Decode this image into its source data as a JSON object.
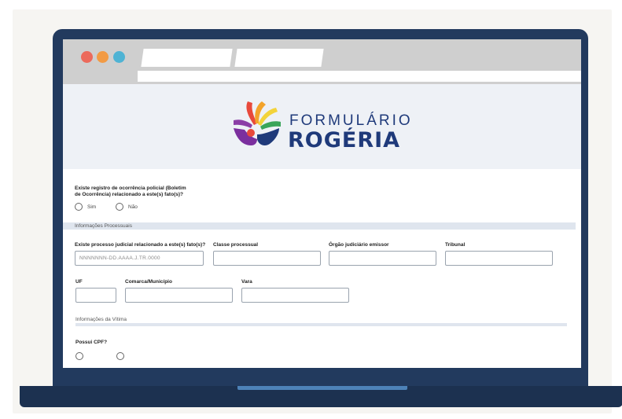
{
  "logo": {
    "line1": "FORMULÁRIO",
    "line2": "ROGÉRIA"
  },
  "question_bo": {
    "label_line1": "Existe registro de ocorrência policial (Boletim",
    "label_line2": "de Ocorrência) relacionado a este(s) fato(s)?",
    "option_yes": "Sim",
    "option_no": "Não"
  },
  "sections": {
    "processuais": "Informações Processuais",
    "vitima": "Informações da Vítima"
  },
  "fields": {
    "processo_label": "Existe processo judicial relacionado a este(s) fato(s)?",
    "processo_placeholder": "NNNNNNN-DD.AAAA.J.TR.0000",
    "classe_label": "Classe processual",
    "orgao_label": "Órgão judiciário emissor",
    "tribunal_label": "Tribunal",
    "uf_label": "UF",
    "comarca_label": "Comarca/Município",
    "vara_label": "Vara",
    "cpf_label": "Possui CPF?"
  },
  "colors": {
    "brand": "#1f3a7a",
    "laptop": "#223a5e",
    "accent": "#4d82b8"
  }
}
